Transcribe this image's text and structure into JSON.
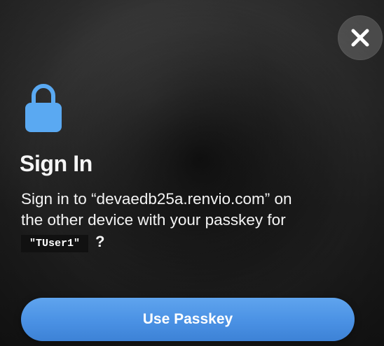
{
  "dialog": {
    "title": "Sign In",
    "message_line1": "Sign in to “devaedb25a.renvio.com” on",
    "message_line2": "the other device with your passkey for",
    "username": "\"TUser1\"",
    "question": "?",
    "primary_button_label": "Use Passkey"
  },
  "icons": {
    "close": "close-icon",
    "lock": "lock-icon"
  },
  "colors": {
    "accent_blue": "#4a91e4",
    "lock_blue": "#5aa9f2",
    "text_white": "#f4f4f4",
    "close_circle": "rgba(210,210,210,0.22)"
  }
}
